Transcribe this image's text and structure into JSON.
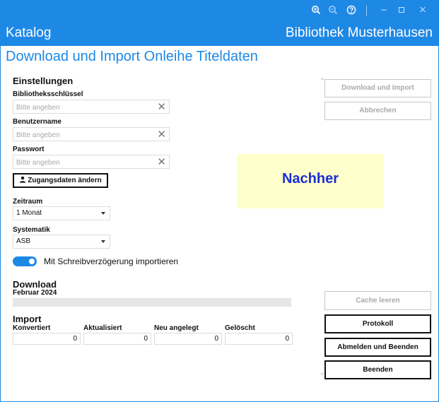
{
  "titlebar": {
    "icons": [
      "zoom-in-icon",
      "zoom-out-icon",
      "help-icon"
    ],
    "window_controls": [
      "minimize-icon",
      "maximize-icon",
      "close-icon"
    ]
  },
  "header": {
    "app_name": "Katalog",
    "library_name": "Bibliothek Musterhausen"
  },
  "page_title": "Download und Import Onleihe Titeldaten",
  "settings": {
    "heading": "Einstellungen",
    "library_key_label": "Bibliotheksschlüssel",
    "library_key_placeholder": "Bitte angeben",
    "library_key_value": "",
    "username_label": "Benutzername",
    "username_placeholder": "Bitte angeben",
    "username_value": "",
    "password_label": "Passwort",
    "password_placeholder": "Bitte angeben",
    "password_value": "",
    "change_credentials_label": "Zugangsdaten ändern",
    "period_label": "Zeitraum",
    "period_value": "1 Monat",
    "systematics_label": "Systematik",
    "systematics_value": "ASB",
    "throttle_label": "Mit Schreibverzögerung importieren",
    "throttle_on": true
  },
  "download": {
    "heading": "Download",
    "month": "Februar 2024",
    "progress": 0
  },
  "import": {
    "heading": "Import",
    "columns": [
      {
        "label": "Konvertiert",
        "value": "0"
      },
      {
        "label": "Aktualisiert",
        "value": "0"
      },
      {
        "label": "Neu angelegt",
        "value": "0"
      },
      {
        "label": "Gelöscht",
        "value": "0"
      }
    ]
  },
  "actions": {
    "download_import": "Download und Import",
    "cancel": "Abbrechen",
    "clear_cache": "Cache leeren",
    "log": "Protokoll",
    "logout_exit": "Abmelden und Beenden",
    "exit": "Beenden"
  },
  "overlay_note": "Nachher",
  "colors": {
    "accent": "#1e88e5",
    "note_background": "#ffffcc",
    "note_text": "#1a2ed4"
  }
}
